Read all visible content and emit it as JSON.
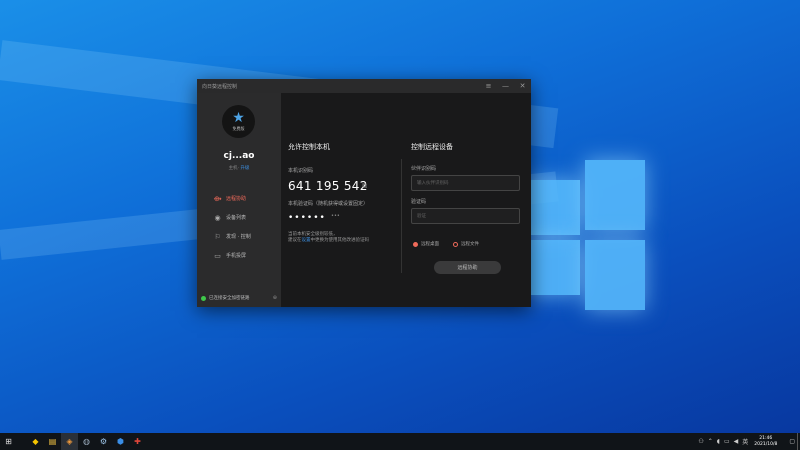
{
  "window": {
    "title": "向日葵远程控制",
    "controls": [
      "≡",
      "—",
      "✕"
    ]
  },
  "sidebar": {
    "avatar_tag": "免费版",
    "username": "cj...ao",
    "status_prefix": "主机·",
    "status_link": "升级",
    "items": [
      {
        "label": "远程协助",
        "icon": "remote-assist-icon",
        "glyph": "⟴",
        "active": true
      },
      {
        "label": "设备列表",
        "icon": "device-list-icon",
        "glyph": "◉",
        "active": false
      },
      {
        "label": "发现 · 控制",
        "icon": "discover-icon",
        "glyph": "⚐",
        "active": false
      },
      {
        "label": "手机投屏",
        "icon": "screen-cast-icon",
        "glyph": "▭",
        "active": false
      }
    ],
    "footer_status": "已连接安全加密链路"
  },
  "allow_control": {
    "title": "允许控制本机",
    "device_id_label": "本机识别码",
    "device_id": "641 195 542",
    "password_label": "本机验证码（随机获得或设置固定）",
    "password_mask": "••••••",
    "password_toggle": "•••",
    "hint_line1": "当前本机安全级别较低，",
    "hint_prefix": "建议在",
    "hint_link": "设置",
    "hint_suffix": "中更换为使用其他改进验证码"
  },
  "control_remote": {
    "title": "控制远程设备",
    "partner_label": "伙伴识别码",
    "partner_placeholder": "输入伙伴识别码",
    "code_label": "验证码",
    "code_placeholder": "验证",
    "radio_desktop": "远程桌面",
    "radio_file": "远程文件",
    "connect_label": "远程协助"
  },
  "taskbar": {
    "icons": [
      {
        "name": "start-icon",
        "glyph": "⊞"
      },
      {
        "name": "norton-icon",
        "glyph": "◆"
      },
      {
        "name": "file-explorer-icon",
        "glyph": "▤"
      },
      {
        "name": "sunlogin-icon",
        "glyph": "◈"
      },
      {
        "name": "app-icon",
        "glyph": "◍"
      },
      {
        "name": "steam-icon",
        "glyph": "⚙"
      },
      {
        "name": "blue-app-icon",
        "glyph": "⬢"
      },
      {
        "name": "red-app-icon",
        "glyph": "✚"
      }
    ],
    "time": "21:46",
    "date": "2021/10/8"
  }
}
